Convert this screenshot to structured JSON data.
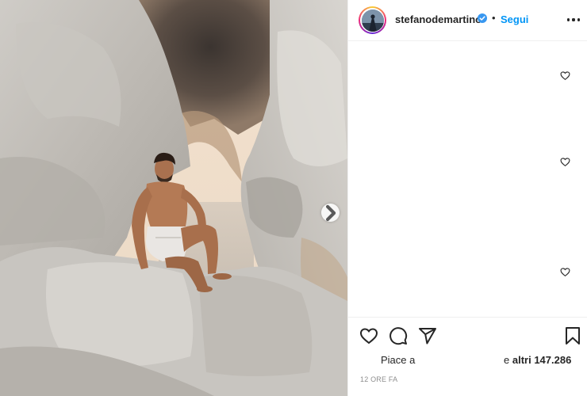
{
  "post": {
    "username": "stefanodemartino",
    "separator": "•",
    "follow_label": "Segui",
    "likes_prefix": "Piace a",
    "likes_suffix_word": "e",
    "likes_others": "altri 147.286",
    "timestamp": "12 ORE FA"
  },
  "icons": {
    "verified": "verified-badge-icon",
    "more": "more-options-icon",
    "like": "heart-icon",
    "comment": "comment-icon",
    "share": "share-icon",
    "save": "bookmark-icon",
    "next": "chevron-right-icon"
  },
  "colors": {
    "accent": "#0095f6",
    "text": "#262626",
    "muted": "#8e8e8e",
    "border": "#efefef"
  }
}
